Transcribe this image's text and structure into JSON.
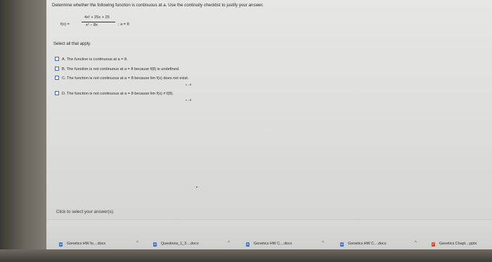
{
  "question": {
    "prompt": "Determine whether the following function is continuous at a. Use the continuity checklist to justify your answer.",
    "function": {
      "lhs": "f(x) =",
      "numerator": "4x² + 25x + 25",
      "denominator": "x² − 8x",
      "condition": "; a = 8"
    },
    "instruction": "Select all that apply.",
    "options": [
      {
        "letter": "A.",
        "text": "The function is continuous at a = 8."
      },
      {
        "letter": "B.",
        "text": "The function is not continuous at a = 8 because f(8) is undefined."
      },
      {
        "letter": "C.",
        "text": "The function is not continuous at a = 8 because  lim  f(x) does not exist.",
        "sub": "x→8"
      },
      {
        "letter": "D.",
        "text": "The function is not continuous at a = 8 because  lim  f(x) ≠ f(8).",
        "sub": "x→8"
      }
    ],
    "hint": "Click to select your answer(s)."
  },
  "downloads": [
    {
      "name": "Genetics HW fo....docx",
      "icon": "word-doc-icon"
    },
    {
      "name": "Questions_1_3....docx",
      "icon": "word-doc-icon"
    },
    {
      "name": "Genetics HW C....docx",
      "icon": "word-doc-icon"
    },
    {
      "name": "Genetics HW C....docx",
      "icon": "word-doc-icon"
    },
    {
      "name": "Genetics Chapt....pptx",
      "icon": "powerpoint-icon"
    }
  ],
  "chevron": "^",
  "colors": {
    "checkbox_border": "#3d6fb0",
    "doc_icon": "#3b6cc0",
    "ppt_icon": "#c9482b"
  }
}
